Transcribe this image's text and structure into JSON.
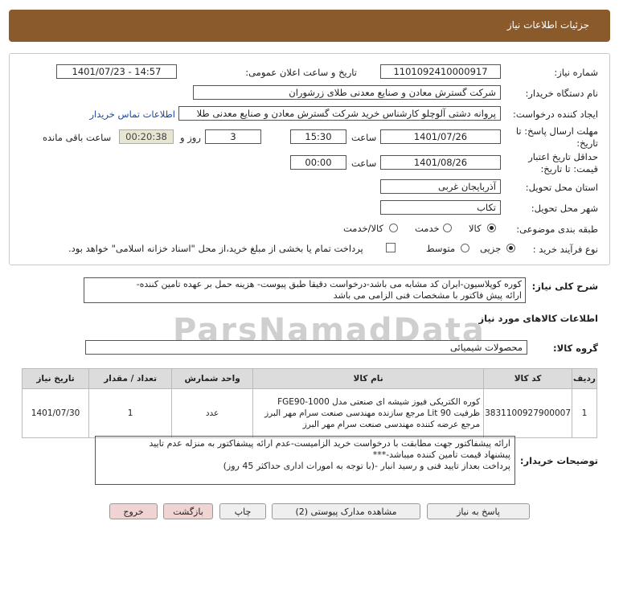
{
  "header": {
    "title": "جزئیات اطلاعات نیاز"
  },
  "fields": {
    "need_number_label": "شماره نیاز:",
    "need_number": "1101092410000917",
    "announce_label": "تاریخ و ساعت اعلان عمومی:",
    "announce_value": "1401/07/23 - 14:57",
    "buyer_org_label": "نام دستگاه خریدار:",
    "buyer_org": "شرکت گسترش معادن و صنایع معدنی طلای زرشوران",
    "creator_label": "ایجاد کننده درخواست:",
    "creator": "پروانه  دشتی آلوچلو کارشناس خرید شرکت گسترش معادن و صنایع معدنی طلا",
    "contact_link": "اطلاعات تماس خریدار",
    "reply_deadline_label": "مهلت ارسال پاسخ: تا تاریخ:",
    "reply_date": "1401/07/26",
    "time_label": "ساعت",
    "reply_time": "15:30",
    "days_value": "3",
    "days_label": "روز و",
    "remaining_time": "00:20:38",
    "remaining_label": "ساعت باقی مانده",
    "validity_label": "حداقل تاریخ اعتبار قیمت: تا تاریخ:",
    "validity_date": "1401/08/26",
    "validity_time": "00:00",
    "province_label": "استان محل تحویل:",
    "province": "آذربایجان غربی",
    "city_label": "شهر محل تحویل:",
    "city": "تکاب",
    "category_label": "طبقه بندی موضوعی:",
    "category_options": [
      "کالا",
      "خدمت",
      "کالا/خدمت"
    ],
    "category_selected": 0,
    "purchase_type_label": "نوع فرآیند خرید :",
    "purchase_options": [
      "جزیی",
      "متوسط"
    ],
    "purchase_selected": 0,
    "payment_note": "پرداخت تمام یا بخشی از مبلغ خرید،از محل \"اسناد خزانه اسلامی\" خواهد بود."
  },
  "description": {
    "label": "شرح کلی نیاز:",
    "line1": "کوره کوپلاسیون-ایران کد مشابه می باشد-درخواست دقیقا طبق پیوست- هزینه حمل بر عهده تامین کننده-",
    "line2": "ارائه پیش فاکتور با مشخصات فنی الزامی می باشد"
  },
  "goods_section": {
    "title": "اطلاعات کالاهای مورد نیاز",
    "group_label": "گروه کالا:",
    "group_value": "محصولات شیمیائی"
  },
  "table": {
    "headers": [
      "ردیف",
      "کد کالا",
      "نام کالا",
      "واحد شمارش",
      "تعداد / مقدار",
      "تاریخ نیاز"
    ],
    "rows": [
      {
        "row": "1",
        "code": "3831100927900007",
        "name_line1": "کوره الکتریکی فیوز شیشه ای صنعتی مدل FGE90-1000",
        "name_line2": "ظرفیت Lit 90 مرجع سازنده مهندسی صنعت سرام مهر البرز",
        "name_line3": "مرجع عرضه کننده مهندسی صنعت سرام مهر البرز",
        "unit": "عدد",
        "qty": "1",
        "date": "1401/07/30"
      }
    ]
  },
  "buyer_notes": {
    "label": "توضیحات خریدار:",
    "line1": "ارائه پیشفاکتور جهت مطابقت با درخواست خرید الزامیست-عدم ارائه پیشفاکتور به منزله عدم تایید",
    "line2": "پیشنهاد قیمت تامین کننده میباشد-***",
    "line3": "پرداخت بعداز تایید فنی و رسید انبار -(با توجه به امورات اداری حداکثر 45 روز)"
  },
  "buttons": {
    "reply": "پاسخ به نیاز",
    "attachments": "مشاهده مدارک پیوستی (2)",
    "print": "چاپ",
    "back": "بازگشت",
    "exit": "خروج"
  },
  "watermark": "ParsNamadData"
}
